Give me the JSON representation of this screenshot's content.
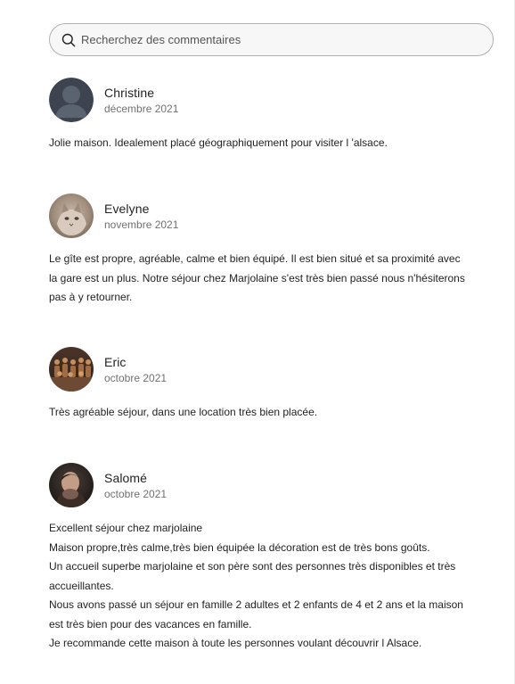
{
  "search": {
    "placeholder": "Recherchez des commentaires",
    "icon": "search-icon"
  },
  "reviews": [
    {
      "name": "Christine",
      "date": "décembre 2021",
      "avatar": "default-user-avatar",
      "lines": [
        "Jolie maison. Idealement placé géographiquement pour visiter l 'alsace."
      ]
    },
    {
      "name": "Evelyne",
      "date": "novembre 2021",
      "avatar": "cat-photo-avatar",
      "lines": [
        "Le gîte est propre, agréable, calme et bien équipé. Il est bien situé et sa proximité avec",
        "la gare est un plus. Notre séjour chez Marjolaine s'est très bien passé nous n'hésiterons",
        "pas à y retourner."
      ]
    },
    {
      "name": "Eric",
      "date": "octobre 2021",
      "avatar": "group-photo-avatar",
      "lines": [
        "Très agréable séjour, dans une location très bien placée."
      ]
    },
    {
      "name": "Salomé",
      "date": "octobre 2021",
      "avatar": "person-photo-avatar",
      "lines": [
        "Excellent séjour chez marjolaine",
        "Maison propre,très calme,très bien équipée la décoration est de très bons goûts.",
        "Un accueil superbe marjolaine et son père sont des personnes très disponibles et très",
        "accueillantes.",
        "Nous avons passé un séjour en famille 2 adultes et 2 enfants de 4 et 2 ans et la maison",
        "est très bien pour des vacances en famille.",
        "Je recommande cette maison à toute les personnes voulant découvrir l Alsace."
      ]
    }
  ]
}
